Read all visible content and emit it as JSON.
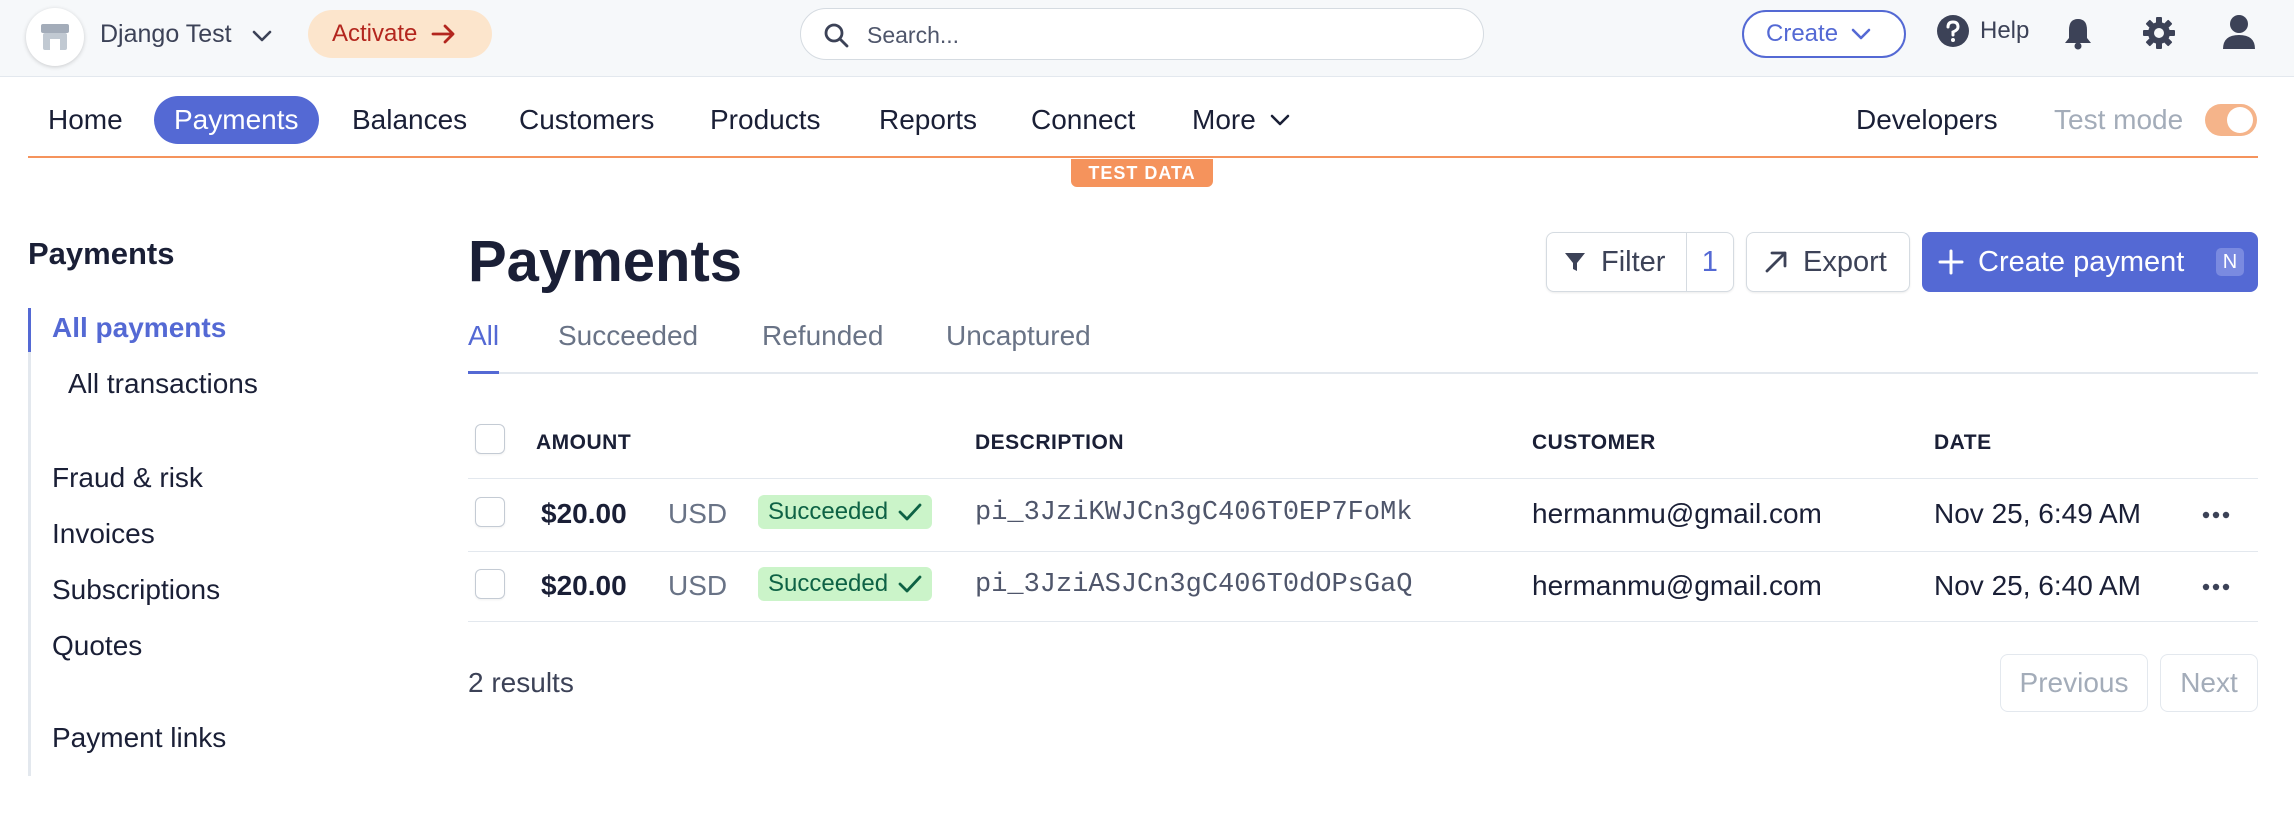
{
  "topbar": {
    "account_name": "Django Test",
    "activate_label": "Activate",
    "search_placeholder": "Search...",
    "create_label": "Create",
    "help_label": "Help"
  },
  "nav": {
    "items": [
      "Home",
      "Payments",
      "Balances",
      "Customers",
      "Products",
      "Reports",
      "Connect",
      "More"
    ],
    "active": "Payments",
    "developers": "Developers",
    "test_mode_label": "Test mode",
    "test_mode_on": true,
    "test_badge": "TEST DATA"
  },
  "sidebar": {
    "title": "Payments",
    "items": [
      {
        "label": "All payments",
        "active": true
      },
      {
        "label": "All transactions",
        "sub": true
      },
      {
        "label": "Fraud & risk"
      },
      {
        "label": "Invoices"
      },
      {
        "label": "Subscriptions"
      },
      {
        "label": "Quotes"
      },
      {
        "label": "Payment links"
      }
    ]
  },
  "main": {
    "title": "Payments",
    "filter_label": "Filter",
    "filter_count": "1",
    "export_label": "Export",
    "create_payment_label": "Create payment",
    "create_payment_shortcut": "N",
    "tabs": [
      "All",
      "Succeeded",
      "Refunded",
      "Uncaptured"
    ],
    "active_tab": "All",
    "columns": {
      "amount": "AMOUNT",
      "description": "DESCRIPTION",
      "customer": "CUSTOMER",
      "date": "DATE"
    },
    "rows": [
      {
        "amount": "$20.00",
        "currency": "USD",
        "status": "Succeeded",
        "description": "pi_3JziKWJCn3gC406T0EP7FoMk",
        "customer": "hermanmu@gmail.com",
        "date": "Nov 25, 6:49 AM"
      },
      {
        "amount": "$20.00",
        "currency": "USD",
        "status": "Succeeded",
        "description": "pi_3JziASJCn3gC406T0dOPsGaQ",
        "customer": "hermanmu@gmail.com",
        "date": "Nov 25, 6:40 AM"
      }
    ],
    "results_text": "2 results",
    "previous_label": "Previous",
    "next_label": "Next"
  },
  "colors": {
    "accent": "#5469d4",
    "test_orange": "#f5935c",
    "success_bg": "#cbf4c9",
    "success_text": "#0e6245"
  }
}
